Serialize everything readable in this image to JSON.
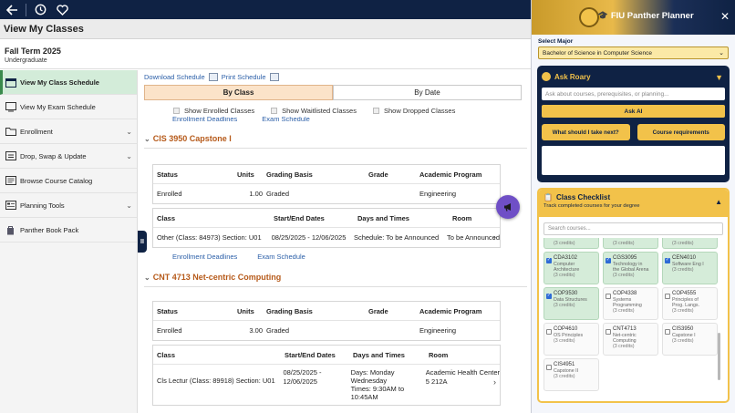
{
  "title": "View My Classes",
  "term": {
    "name": "Fall Term 2025",
    "career": "Undergraduate"
  },
  "sidebar": {
    "items": [
      {
        "label": "View My Class Schedule",
        "icon": "calendar-icon",
        "active": true
      },
      {
        "label": "View My Exam Schedule",
        "icon": "exam-icon"
      },
      {
        "label": "Enrollment",
        "icon": "folder-icon",
        "chevron": true
      },
      {
        "label": "Drop, Swap & Update",
        "icon": "swap-icon",
        "chevron": true
      },
      {
        "label": "Browse Course Catalog",
        "icon": "catalog-icon"
      },
      {
        "label": "Planning Tools",
        "icon": "planning-icon",
        "chevron": true
      },
      {
        "label": "Panther Book Pack",
        "icon": "book-pack-icon"
      }
    ]
  },
  "main": {
    "download_schedule": "Download Schedule",
    "print_schedule": "Print Schedule",
    "tabs": {
      "by_class": "By Class",
      "by_date": "By Date"
    },
    "filters": {
      "enrolled": "Show Enrolled Classes",
      "waitlisted": "Show Waitlisted Classes",
      "dropped": "Show Dropped Classes"
    },
    "enrollment_deadlines": "Enrollment Deadlines",
    "exam_schedule": "Exam Schedule",
    "headers": {
      "status": "Status",
      "units": "Units",
      "grading": "Grading Basis",
      "grade": "Grade",
      "program": "Academic Program",
      "class": "Class",
      "dates": "Start/End Dates",
      "days": "Days and Times",
      "room": "Room"
    },
    "courses": [
      {
        "title": "CIS 3950 Capstone I",
        "status": "Enrolled",
        "units": "1.00",
        "grading": "Graded",
        "grade": "",
        "program": "Engineering",
        "class": "Other (Class: 84973) Section: U01",
        "dates": "08/25/2025 - 12/06/2025",
        "days": "Schedule: To be Announced",
        "room": "To be Announced"
      },
      {
        "title": "CNT 4713 Net-centric Computing",
        "status": "Enrolled",
        "units": "3.00",
        "grading": "Graded",
        "grade": "",
        "program": "Engineering",
        "class": "Cls Lectur (Class: 89918) Section: U01",
        "dates_l1": "08/25/2025 -",
        "dates_l2": "12/06/2025",
        "days_l1": "Days: Monday",
        "days_l2": "Wednesday",
        "days_l3": "Times: 9:30AM to",
        "days_l4": "10:45AM",
        "room_l1": "Academic Health Center",
        "room_l2": "5 212A"
      }
    ]
  },
  "panel": {
    "title": "FIU Panther Planner",
    "major_label": "Select Major",
    "major_value": "Bachelor of Science in Computer Science",
    "roary": {
      "title": "Ask Roary",
      "placeholder": "Ask about courses, prerequisites, or planning...",
      "ask_button": "Ask AI",
      "quick1": "What should I take next?",
      "quick2": "Course requirements"
    },
    "checklist": {
      "title": "Class Checklist",
      "subtitle": "Track completed courses for your degree",
      "search_placeholder": "Search courses...",
      "top_partial": [
        "(3 credits)",
        "(3 credits)",
        "(3 credits)"
      ],
      "courses": [
        {
          "code": "CDA3102",
          "name1": "Computer",
          "name2": "Architecture",
          "credits": "(3 credits)",
          "done": true
        },
        {
          "code": "CGS3095",
          "name1": "Technology in",
          "name2": "the Global Arena",
          "credits": "(3 credits)",
          "done": true
        },
        {
          "code": "CEN4010",
          "name1": "Software Eng I",
          "name2": "",
          "credits": "(3 credits)",
          "done": true
        },
        {
          "code": "COP3530",
          "name1": "Data Structures",
          "name2": "",
          "credits": "(3 credits)",
          "done": true
        },
        {
          "code": "COP4338",
          "name1": "Systems",
          "name2": "Programming",
          "credits": "(3 credits)",
          "done": false
        },
        {
          "code": "COP4555",
          "name1": "Principles of",
          "name2": "Prog. Langs.",
          "credits": "(3 credits)",
          "done": false
        },
        {
          "code": "COP4610",
          "name1": "OS Principles",
          "name2": "",
          "credits": "(3 credits)",
          "done": false
        },
        {
          "code": "CNT4713",
          "name1": "Net-centric",
          "name2": "Computing",
          "credits": "(3 credits)",
          "done": false
        },
        {
          "code": "CIS3950",
          "name1": "Capstone I",
          "name2": "",
          "credits": "(3 credits)",
          "done": false
        },
        {
          "code": "CIS4951",
          "name1": "Capstone II",
          "name2": "",
          "credits": "(3 credits)",
          "done": false
        }
      ]
    }
  },
  "colors": {
    "navy": "#0f2244",
    "gold": "#f2c24a",
    "accent_orange": "#b65a1a",
    "link": "#2b5fa8",
    "active_green": "#d3ecd9",
    "fab_purple": "#6f4fc6"
  }
}
